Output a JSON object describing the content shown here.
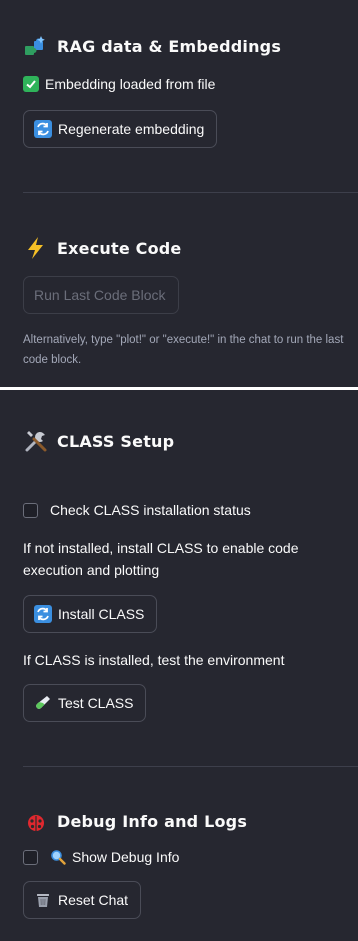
{
  "rag": {
    "title": "RAG data & Embeddings",
    "status": "Embedding loaded from file",
    "regenerate_label": "Regenerate embedding"
  },
  "execute": {
    "title": "Execute Code",
    "run_label": "Run Last Code Block",
    "hint": "Alternatively, type \"plot!\" or \"execute!\" in the chat to run the last code block."
  },
  "class_setup": {
    "title": "CLASS Setup",
    "check_label": "Check CLASS installation status",
    "install_hint": "If not installed, install CLASS to enable code execution and plotting",
    "install_label": "Install CLASS",
    "test_hint": "If CLASS is installed, test the environment",
    "test_label": "Test CLASS"
  },
  "debug": {
    "title": "Debug Info and Logs",
    "show_debug_label": "Show Debug Info",
    "reset_label": "Reset Chat"
  },
  "colors": {
    "panel_bg": "#262730",
    "text": "#fafafa",
    "muted": "#a3a8b8",
    "border": "#4a4c57",
    "lightning": "#f6c026",
    "checkmark_bg": "#2fb35a",
    "refresh_bg": "#3b8fe0"
  },
  "icons": {
    "rag": "puzzle-icon",
    "status": "checkmark-icon",
    "regenerate": "refresh-icon",
    "execute": "lightning-icon",
    "class_setup": "tools-icon",
    "install": "refresh-icon",
    "test": "test-tube-icon",
    "debug": "ladybug-icon",
    "show_debug": "magnifier-icon",
    "reset": "trash-icon"
  }
}
